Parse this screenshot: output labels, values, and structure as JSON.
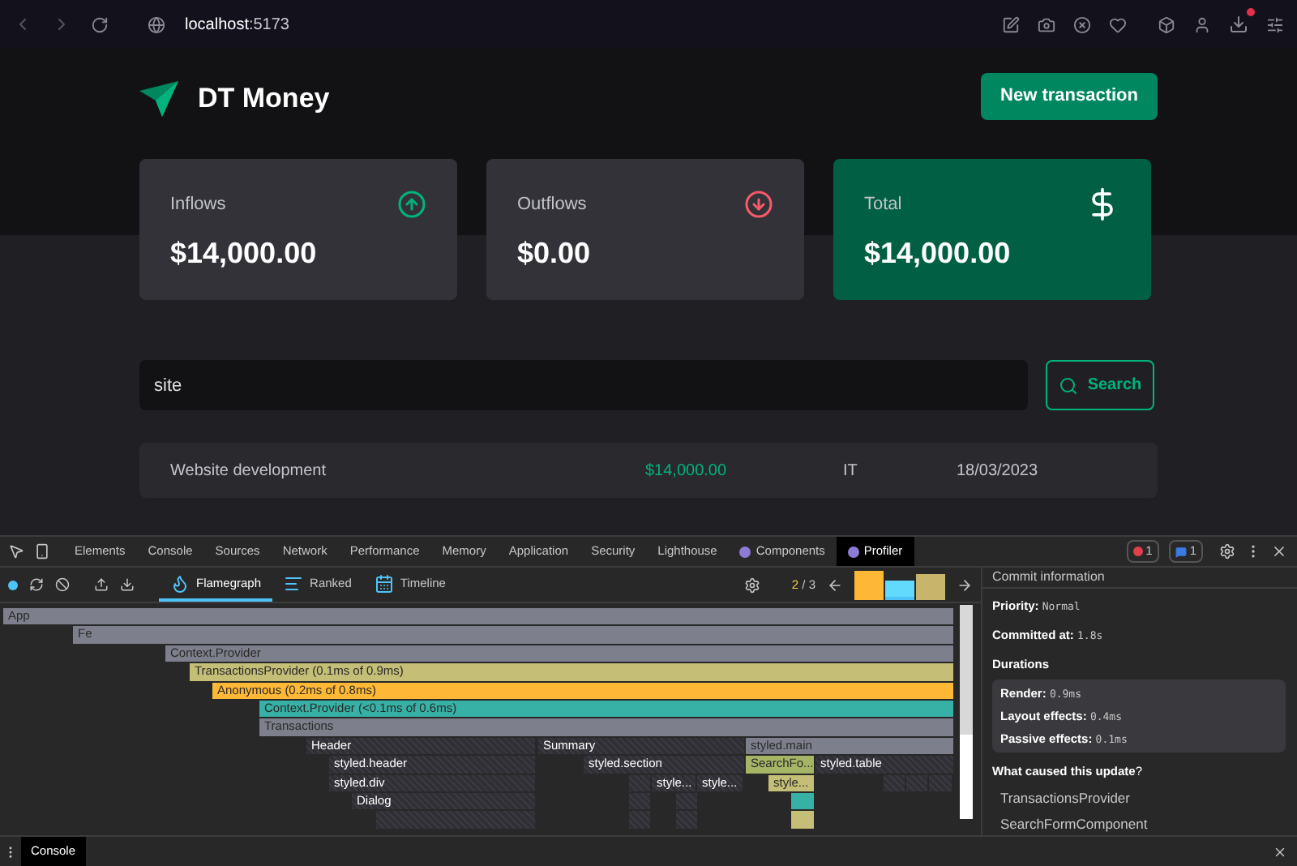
{
  "browser": {
    "address_host": "localhost",
    "address_port": ":5173"
  },
  "app": {
    "logo_text": "DT Money",
    "new_button": "New transaction",
    "cards": [
      {
        "label": "Inflows",
        "value": "$14,000.00",
        "kind": "inflow"
      },
      {
        "label": "Outflows",
        "value": "$0.00",
        "kind": "outflow"
      },
      {
        "label": "Total",
        "value": "$14,000.00",
        "kind": "total"
      }
    ],
    "search": {
      "value": "site",
      "button": "Search"
    },
    "transactions": [
      {
        "description": "Website development",
        "price": "$14,000.00",
        "color": "#00b37e",
        "category": "IT",
        "date": "18/03/2023"
      }
    ]
  },
  "devtools": {
    "tabs": [
      {
        "label": "Elements",
        "selected": false
      },
      {
        "label": "Console",
        "selected": false
      },
      {
        "label": "Sources",
        "selected": false
      },
      {
        "label": "Network",
        "selected": false
      },
      {
        "label": "Performance",
        "selected": false
      },
      {
        "label": "Memory",
        "selected": false
      },
      {
        "label": "Application",
        "selected": false
      },
      {
        "label": "Security",
        "selected": false
      },
      {
        "label": "Lighthouse",
        "selected": false
      },
      {
        "label": "Components",
        "selected": false,
        "kind": "react"
      },
      {
        "label": "Profiler",
        "selected": true,
        "kind": "react"
      }
    ],
    "error_count": "1",
    "message_count": "1",
    "profiler_tabs": [
      {
        "label": "Flamegraph",
        "selected": true,
        "kind": "flame"
      },
      {
        "label": "Ranked",
        "selected": false,
        "kind": "ranked"
      },
      {
        "label": "Timeline",
        "selected": false,
        "kind": "timeline"
      }
    ],
    "commit_index": "2",
    "commit_sep": "/",
    "commit_total": "3",
    "commits": [
      {
        "color": "#ffb836",
        "selected": false
      },
      {
        "color": "#61dafb",
        "selected": true
      },
      {
        "color": "#c8b46a",
        "selected": false
      }
    ],
    "flamegraph": [
      [
        {
          "label": "App",
          "kind": "rendered",
          "color": "#7d7f8c"
        }
      ],
      [
        {
          "label": "Fe",
          "kind": "rendered",
          "color": "#7d7f8c"
        }
      ],
      [
        {
          "label": "Context.Provider",
          "kind": "rendered",
          "color": "#7d7f8c"
        }
      ],
      [
        {
          "label": "TransactionsProvider (0.1ms of 0.9ms)",
          "kind": "rendered",
          "color": "#c4be76"
        }
      ],
      [
        {
          "label": "Anonymous (0.2ms of 0.8ms)",
          "kind": "rendered",
          "color": "#ffb836"
        }
      ],
      [
        {
          "label": "Context.Provider (<0.1ms of 0.6ms)",
          "kind": "rendered",
          "color": "#37b1a5"
        }
      ],
      [
        {
          "label": "Transactions",
          "kind": "rendered",
          "color": "#7d7f8c"
        }
      ],
      [
        {
          "label": "Header",
          "kind": "skipped"
        },
        {
          "label": "Summary",
          "kind": "skipped"
        },
        {
          "label": "styled.main",
          "kind": "rendered",
          "color": "#7d7f8c"
        }
      ],
      [
        {
          "label": "styled.header",
          "kind": "skipped"
        },
        {
          "label": "styled.section",
          "kind": "skipped"
        },
        {
          "label": "SearchFo...",
          "kind": "rendered",
          "color": "#a6b466"
        },
        {
          "label": "styled.table",
          "kind": "skipped"
        }
      ],
      [
        {
          "label": "styled.div",
          "kind": "skipped"
        },
        {
          "kind": "skipped"
        },
        {
          "label": "style...",
          "kind": "skipped"
        },
        {
          "label": "style...",
          "kind": "skipped"
        },
        {
          "label": "style...",
          "kind": "rendered",
          "color": "#c4be76"
        },
        {
          "kind": "skipped"
        },
        {
          "kind": "skipped"
        },
        {
          "kind": "skipped"
        }
      ],
      [
        {
          "label": "Dialog",
          "kind": "skipped"
        },
        {
          "kind": "skipped"
        },
        {
          "kind": "skipped"
        },
        {
          "kind": "rendered",
          "color": "#37b1a5"
        }
      ],
      [
        {
          "kind": "skipped"
        },
        {
          "kind": "skipped"
        },
        {
          "kind": "skipped"
        },
        {
          "kind": "rendered",
          "color": "#c4be76"
        }
      ]
    ],
    "commit_info": {
      "title": "Commit information",
      "priority_label": "Priority:",
      "priority": "Normal",
      "committed_label": "Committed at:",
      "committed": "1.8s",
      "durations_label": "Durations",
      "durations": [
        {
          "label": "Render:",
          "value": "0.9ms"
        },
        {
          "label": "Layout effects:",
          "value": "0.4ms"
        },
        {
          "label": "Passive effects:",
          "value": "0.1ms"
        }
      ],
      "cause_label": "What caused this update",
      "cause_mark": "?",
      "causes": [
        "TransactionsProvider",
        "SearchFormComponent"
      ]
    },
    "drawer_tab": "Console"
  }
}
